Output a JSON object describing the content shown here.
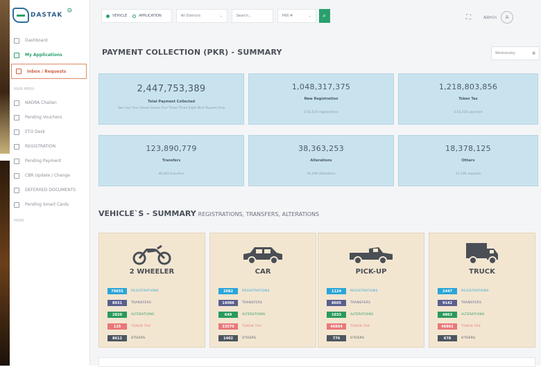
{
  "brand": {
    "name": "DASTAK"
  },
  "sidebar": {
    "items": [
      {
        "label": "Dashboard",
        "icon": "dashboard-icon"
      },
      {
        "label": "My Applications",
        "icon": "document-icon"
      },
      {
        "label": "Inbox / Requests",
        "icon": "inbox-icon"
      }
    ],
    "section1": "MAIN MENU",
    "items2": [
      {
        "label": "NADRA Challan"
      },
      {
        "label": "Pending Vouchers"
      },
      {
        "label": "ETO Desk"
      },
      {
        "label": "REGISTRATION"
      },
      {
        "label": "Pending Payment"
      },
      {
        "label": "CBR Update / Change"
      },
      {
        "label": "DEFERRED DOCUMENTS"
      },
      {
        "label": "Pending Smart Cards"
      }
    ],
    "section2": "MORE"
  },
  "topbar": {
    "radio1": "VEHICLE",
    "radio2": "APPLICATION",
    "district": "All Districts",
    "search_placeholder": "Search...",
    "filter": "PKR #",
    "user": "Admin",
    "avatar": "A"
  },
  "summary": {
    "title": "PAYMENT COLLECTION (PKR) - SUMMARY",
    "period": "Wednesday",
    "cards": [
      {
        "value": "2,447,753,389",
        "label": "Total Payment Collected",
        "sub": "Two Four Four Seven Seven Five Three Three Eight Nine Rupees Only"
      },
      {
        "value": "1,048,317,375",
        "label": "New Registration",
        "sub": "1,02,518 registrations"
      },
      {
        "value": "1,218,803,856",
        "label": "Token Tax",
        "sub": "3,62,216 payment"
      },
      {
        "value": "123,890,779",
        "label": "Transfers",
        "sub": "46,482 transfers"
      },
      {
        "value": "38,363,253",
        "label": "Alterations",
        "sub": "30,199 alterations"
      },
      {
        "value": "18,378,125",
        "label": "Others",
        "sub": "11,536 requests"
      }
    ]
  },
  "vehicles": {
    "title": "VEHICLE`S - SUMMARY",
    "subtitle": "REGISTRATIONS, TRANSFERS, ALTERATIONS",
    "labels": [
      "REGISTRATIONS",
      "TRANSFERS",
      "ALTERATIONS",
      "TOKEN TAX",
      "OTHERS"
    ],
    "items": [
      {
        "name": "2 WHEELER",
        "icon": "motorcycle-icon",
        "values": [
          "79655",
          "8931",
          "2820",
          "125",
          "8612"
        ]
      },
      {
        "name": "CAR",
        "icon": "car-icon",
        "values": [
          "2082",
          "14086",
          "649",
          "33570",
          "1402"
        ]
      },
      {
        "name": "PICK-UP",
        "icon": "pickup-truck-icon",
        "values": [
          "1124",
          "8605",
          "1033",
          "46864",
          "776"
        ]
      },
      {
        "name": "TRUCK",
        "icon": "truck-icon",
        "values": [
          "2447",
          "9142",
          "4863",
          "46862",
          "678"
        ]
      }
    ]
  }
}
